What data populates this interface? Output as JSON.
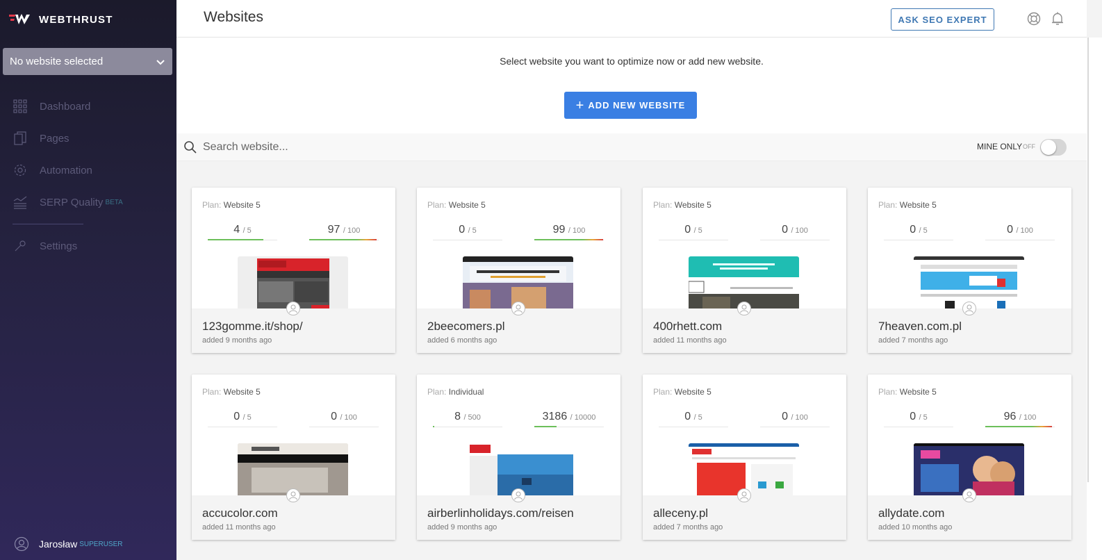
{
  "app": {
    "name": "WEBTHRUST"
  },
  "sidebar": {
    "site_select": "No website selected",
    "items": [
      {
        "label": "Dashboard",
        "icon": "grid-icon"
      },
      {
        "label": "Pages",
        "icon": "pages-icon"
      },
      {
        "label": "Automation",
        "icon": "gear-icon"
      },
      {
        "label": "SERP Quality",
        "badge": "BETA",
        "icon": "chart-icon"
      },
      {
        "label": "Settings",
        "icon": "wrench-icon"
      }
    ],
    "user": {
      "name": "Jarosław",
      "role": "SUPERUSER"
    }
  },
  "header": {
    "title": "Websites",
    "ask_button": "ASK SEO EXPERT"
  },
  "intro": {
    "text": "Select website you want to optimize now or add new website.",
    "add_button": "ADD NEW WEBSITE"
  },
  "search": {
    "placeholder": "Search website...",
    "mine_label": "MINE ONLY",
    "mine_state": "OFF"
  },
  "colors": {
    "accent": "#3a7fe3",
    "sidebar": "#1b1a2b",
    "bar_green": "#6cbf5a",
    "bar_orange": "#e8a53a"
  },
  "websites": [
    {
      "plan_label": "Plan:",
      "plan": "Website 5",
      "m1": "4",
      "m1_max": "/ 5",
      "m1_frac": 0.8,
      "m2": "97",
      "m2_max": "/ 100",
      "m2_frac": 0.97,
      "name": "123gomme.it/shop/",
      "added": "added 9 months ago"
    },
    {
      "plan_label": "Plan:",
      "plan": "Website 5",
      "m1": "0",
      "m1_max": "/ 5",
      "m1_frac": 0,
      "m2": "99",
      "m2_max": "/ 100",
      "m2_frac": 0.99,
      "name": "2beecomers.pl",
      "added": "added 6 months ago"
    },
    {
      "plan_label": "Plan:",
      "plan": "Website 5",
      "m1": "0",
      "m1_max": "/ 5",
      "m1_frac": 0,
      "m2": "0",
      "m2_max": "/ 100",
      "m2_frac": 0,
      "name": "400rhett.com",
      "added": "added 11 months ago"
    },
    {
      "plan_label": "Plan:",
      "plan": "Website 5",
      "m1": "0",
      "m1_max": "/ 5",
      "m1_frac": 0,
      "m2": "0",
      "m2_max": "/ 100",
      "m2_frac": 0,
      "name": "7heaven.com.pl",
      "added": "added 7 months ago"
    },
    {
      "plan_label": "Plan:",
      "plan": "Website 5",
      "m1": "0",
      "m1_max": "/ 5",
      "m1_frac": 0,
      "m2": "0",
      "m2_max": "/ 100",
      "m2_frac": 0,
      "name": "accucolor.com",
      "added": "added 11 months ago"
    },
    {
      "plan_label": "Plan:",
      "plan": "Individual",
      "m1": "8",
      "m1_max": "/ 500",
      "m1_frac": 0.016,
      "m2": "3186",
      "m2_max": "/ 10000",
      "m2_frac": 0.3186,
      "name": "airberlinholidays.com/reisen",
      "added": "added 9 months ago"
    },
    {
      "plan_label": "Plan:",
      "plan": "Website 5",
      "m1": "0",
      "m1_max": "/ 5",
      "m1_frac": 0,
      "m2": "0",
      "m2_max": "/ 100",
      "m2_frac": 0,
      "name": "alleceny.pl",
      "added": "added 7 months ago"
    },
    {
      "plan_label": "Plan:",
      "plan": "Website 5",
      "m1": "0",
      "m1_max": "/ 5",
      "m1_frac": 0,
      "m2": "96",
      "m2_max": "/ 100",
      "m2_frac": 0.96,
      "name": "allydate.com",
      "added": "added 10 months ago"
    }
  ]
}
